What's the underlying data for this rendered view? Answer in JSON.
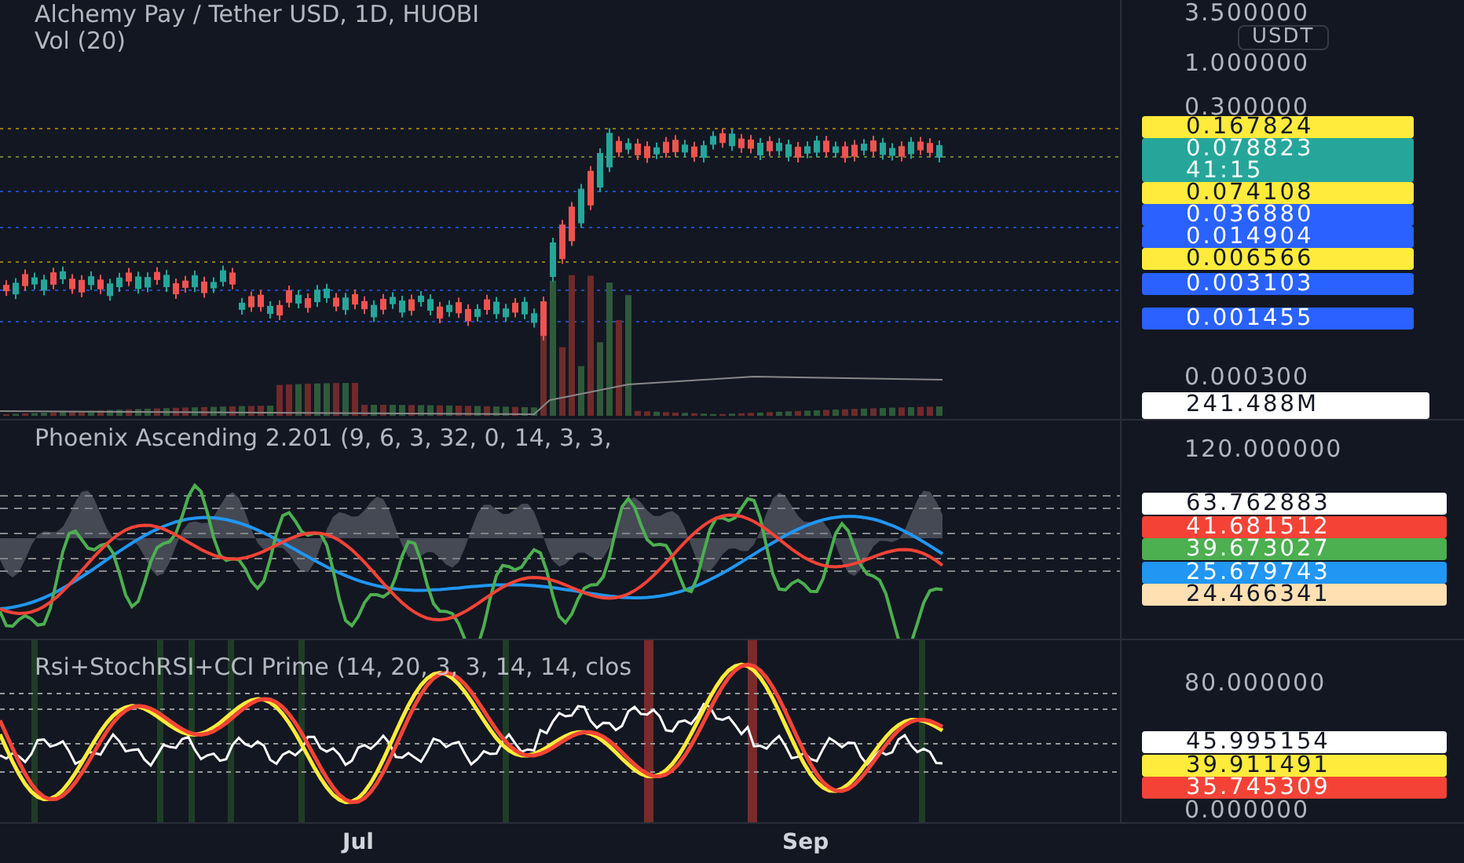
{
  "main_pane": {
    "title": "Alchemy Pay / Tether USD, 1D, HUOBI",
    "subtitle": "Vol (20)",
    "axis_labels": [
      "3.500000",
      "1.000000",
      "0.300000",
      "0.000300"
    ],
    "currency_badge": "USDT",
    "price_tags": [
      {
        "value": "0.167824",
        "color": "#ffeb3b"
      },
      {
        "value": "0.078823",
        "countdown": "41:15",
        "color": "#26a69a"
      },
      {
        "value": "0.074108",
        "color": "#ffeb3b"
      },
      {
        "value": "0.036880",
        "color": "#2962ff"
      },
      {
        "value": "0.014904",
        "color": "#2962ff"
      },
      {
        "value": "0.006566",
        "color": "#ffeb3b"
      },
      {
        "value": "0.003103",
        "color": "#2962ff"
      },
      {
        "value": "0.001455",
        "color": "#2962ff"
      }
    ],
    "volume_tag": {
      "value": "241.488M",
      "color": "#ffffff"
    }
  },
  "phoenix_pane": {
    "title": "Phoenix Ascending 2.201 (9, 6, 3, 32, 0, 14, 3, 3,",
    "axis_labels": [
      "120.000000"
    ],
    "value_tags": [
      {
        "value": "63.762883",
        "color": "#ffffff"
      },
      {
        "value": "41.681512",
        "color": "#f44336"
      },
      {
        "value": "39.673027",
        "color": "#4caf50"
      },
      {
        "value": "25.679743",
        "color": "#2196f3"
      },
      {
        "value": "24.466341",
        "color": "#ffe0b2"
      }
    ]
  },
  "rsi_pane": {
    "title": "Rsi+StochRSI+CCI Prime (14, 20, 3, 3, 14, 14, clos",
    "axis_labels": [
      "80.000000",
      "0.000000"
    ],
    "value_tags": [
      {
        "value": "45.995154",
        "color": "#ffffff"
      },
      {
        "value": "39.911491",
        "color": "#ffeb3b"
      },
      {
        "value": "35.745309",
        "color": "#f44336"
      }
    ]
  },
  "time_axis": [
    "Jul",
    "Sep"
  ]
}
